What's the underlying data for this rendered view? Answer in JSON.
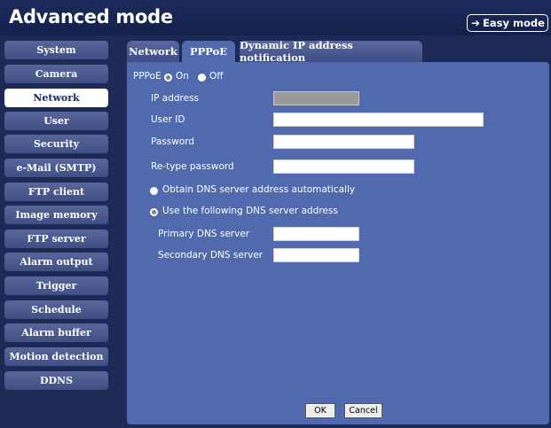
{
  "header": {
    "title": "Advanced mode",
    "easy_mode_label": "Easy mode",
    "easy_mode_icon": "arrow-right-icon"
  },
  "sidebar": {
    "active": "Network",
    "items": [
      {
        "label": "System"
      },
      {
        "label": "Camera"
      },
      {
        "label": "Network"
      },
      {
        "label": "User"
      },
      {
        "label": "Security"
      },
      {
        "label": "e-Mail (SMTP)"
      },
      {
        "label": "FTP client"
      },
      {
        "label": "Image memory"
      },
      {
        "label": "FTP server"
      },
      {
        "label": "Alarm output"
      },
      {
        "label": "Trigger"
      },
      {
        "label": "Schedule"
      },
      {
        "label": "Alarm buffer"
      },
      {
        "label": "Motion detection"
      },
      {
        "label": "DDNS"
      }
    ]
  },
  "tabs": [
    {
      "label": "Network"
    },
    {
      "label": "PPPoE",
      "active": true
    },
    {
      "label": "Dynamic IP address notification"
    }
  ],
  "form": {
    "pppoe_label": "PPPoE",
    "on_label": "On",
    "off_label": "Off",
    "pppoe_state": "On",
    "ip_address_label": "IP address",
    "ip_address_value": "",
    "user_id_label": "User ID",
    "user_id_value": "",
    "password_label": "Password",
    "password_value": "",
    "retype_password_label": "Re-type password",
    "retype_password_value": "",
    "dns_auto_label": "Obtain DNS server address automatically",
    "dns_manual_label": "Use the following DNS server address",
    "dns_mode": "manual",
    "primary_dns_label": "Primary DNS server",
    "primary_dns_value": "",
    "secondary_dns_label": "Secondary DNS server",
    "secondary_dns_value": ""
  },
  "buttons": {
    "ok_label": "OK",
    "cancel_label": "Cancel"
  },
  "colors": {
    "background": "#1c2a55",
    "panel": "#506aad",
    "sidebar_item": "#4a5a8f",
    "active_item": "#ffffff"
  }
}
